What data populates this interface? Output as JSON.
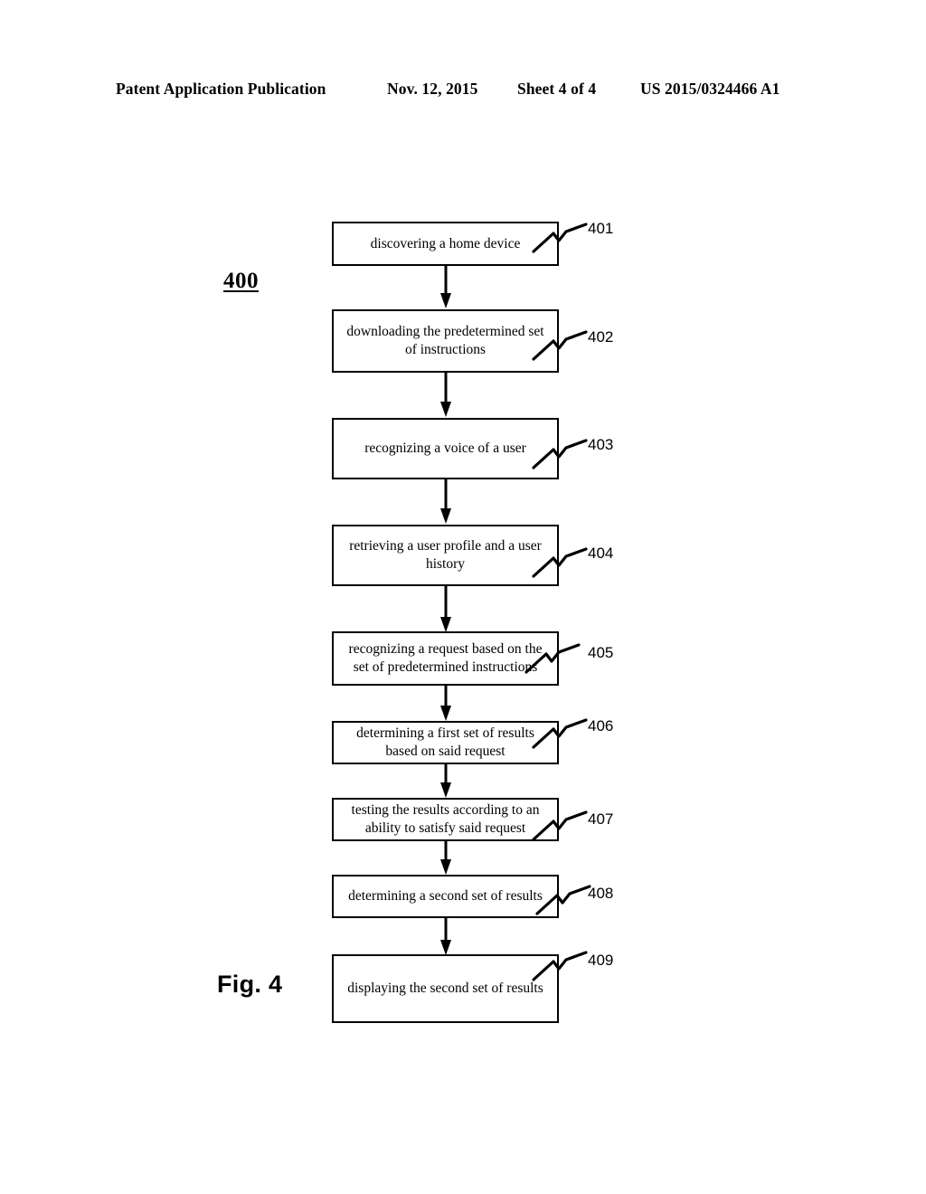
{
  "header": {
    "publication": "Patent Application Publication",
    "date": "Nov. 12, 2015",
    "sheet": "Sheet 4 of 4",
    "doc_number": "US 2015/0324466 A1"
  },
  "figure": {
    "id_label": "400",
    "caption": "Fig. 4",
    "steps": [
      {
        "ref": "401",
        "text": "discovering a home device"
      },
      {
        "ref": "402",
        "text": "downloading the predetermined set of instructions"
      },
      {
        "ref": "403",
        "text": "recognizing a voice of a user"
      },
      {
        "ref": "404",
        "text": "retrieving a user profile and a user history"
      },
      {
        "ref": "405",
        "text": "recognizing a request based on the set of predetermined instructions"
      },
      {
        "ref": "406",
        "text": "determining a first set of results based on said request"
      },
      {
        "ref": "407",
        "text": "testing the results according to an ability to satisfy said request"
      },
      {
        "ref": "408",
        "text": "determining a second set of results"
      },
      {
        "ref": "409",
        "text": "displaying the second set of results"
      }
    ]
  },
  "colors": {
    "ink": "#000000",
    "paper": "#ffffff"
  }
}
